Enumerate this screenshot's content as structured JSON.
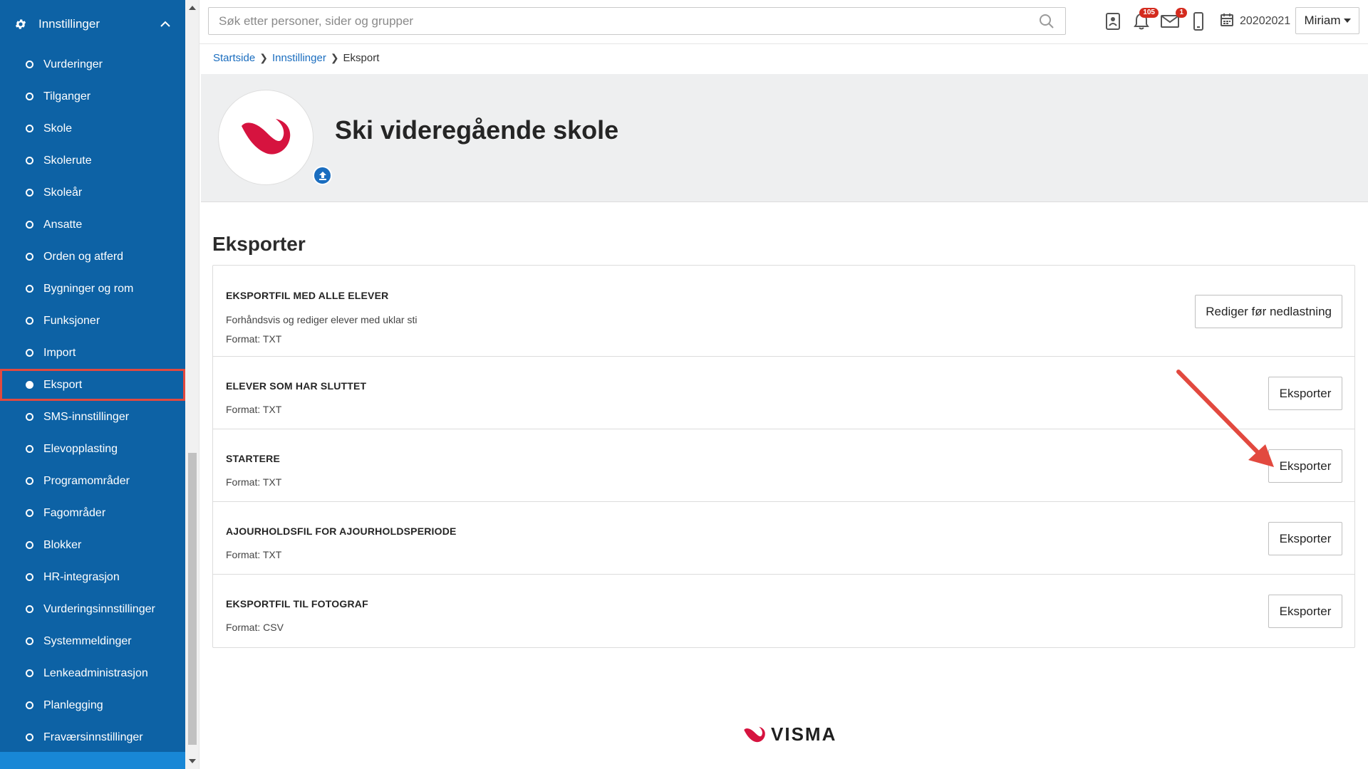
{
  "sidebar": {
    "header_label": "Innstillinger",
    "items": [
      {
        "label": "Vurderinger"
      },
      {
        "label": "Tilganger"
      },
      {
        "label": "Skole"
      },
      {
        "label": "Skolerute"
      },
      {
        "label": "Skoleår"
      },
      {
        "label": "Ansatte"
      },
      {
        "label": "Orden og atferd"
      },
      {
        "label": "Bygninger og rom"
      },
      {
        "label": "Funksjoner"
      },
      {
        "label": "Import"
      },
      {
        "label": "Eksport",
        "active": true
      },
      {
        "label": "SMS-innstillinger"
      },
      {
        "label": "Elevopplasting"
      },
      {
        "label": "Programområder"
      },
      {
        "label": "Fagområder"
      },
      {
        "label": "Blokker"
      },
      {
        "label": "HR-integrasjon"
      },
      {
        "label": "Vurderingsinnstillinger"
      },
      {
        "label": "Systemmeldinger"
      },
      {
        "label": "Lenkeadministrasjon"
      },
      {
        "label": "Planlegging"
      },
      {
        "label": "Fraværsinnstillinger"
      }
    ]
  },
  "topbar": {
    "search_placeholder": "Søk etter personer, sider og grupper",
    "notifications_count": "105",
    "messages_count": "1",
    "year": "20202021",
    "user": "Miriam"
  },
  "breadcrumb": {
    "items": [
      "Startside",
      "Innstillinger"
    ],
    "current": "Eksport"
  },
  "header": {
    "school_name": "Ski videregående skole"
  },
  "main": {
    "section_title": "Eksporter",
    "rows": [
      {
        "title": "EKSPORTFIL MED ALLE ELEVER",
        "description": "Forhåndsvis og rediger elever med uklar sti",
        "format": "Format: TXT",
        "button": "Rediger før nedlastning"
      },
      {
        "title": "ELEVER SOM HAR SLUTTET",
        "format": "Format: TXT",
        "button": "Eksporter"
      },
      {
        "title": "STARTERE",
        "format": "Format: TXT",
        "button": "Eksporter"
      },
      {
        "title": "AJOURHOLDSFIL FOR AJOURHOLDSPERIODE",
        "format": "Format: TXT",
        "button": "Eksporter"
      },
      {
        "title": "EKSPORTFIL TIL FOTOGRAF",
        "format": "Format: CSV",
        "button": "Eksporter"
      }
    ]
  },
  "footer": {
    "brand": "VISMA"
  },
  "colors": {
    "sidebar_bg": "#0d62a5",
    "accent": "#1a6dbf",
    "highlight": "#e2493f",
    "badge": "#d42b1e",
    "logo_red": "#d6133f"
  },
  "icons": [
    "gear-icon",
    "chevron-up-icon",
    "search-icon",
    "contact-card-icon",
    "bell-icon",
    "envelope-icon",
    "mobile-icon",
    "calendar-icon",
    "upload-icon",
    "visma-logo"
  ]
}
